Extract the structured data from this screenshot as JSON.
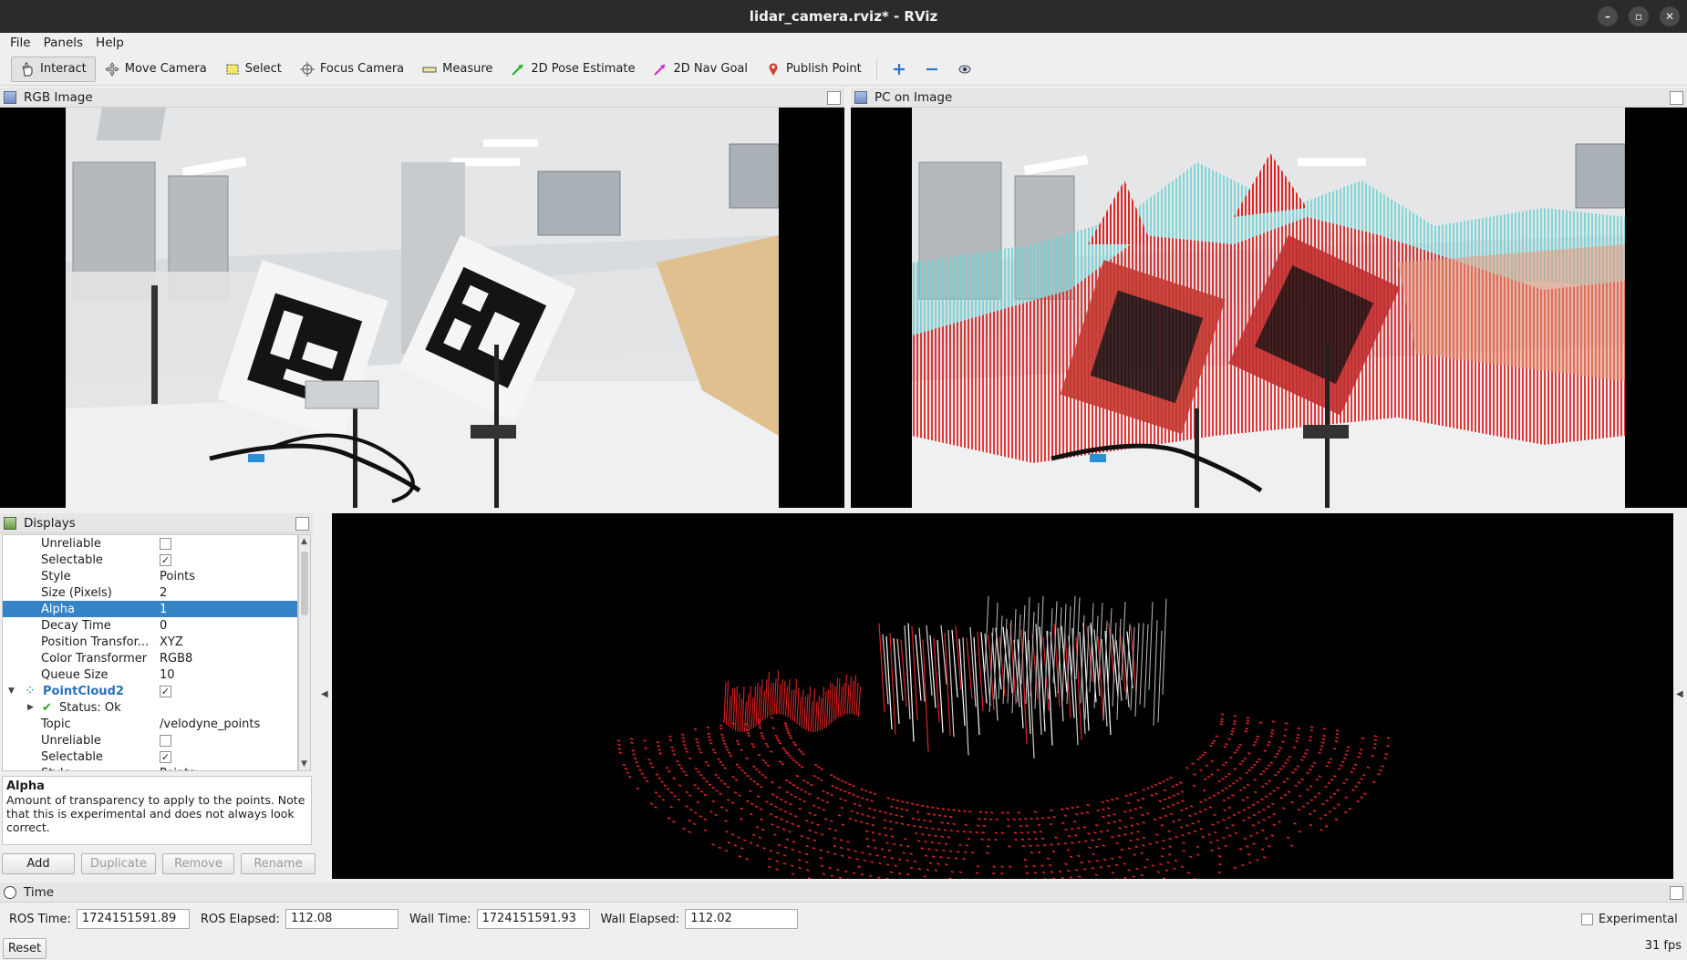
{
  "window": {
    "title": "lidar_camera.rviz* - RViz"
  },
  "menu": [
    "File",
    "Panels",
    "Help"
  ],
  "toolbar": {
    "interact": "Interact",
    "move_camera": "Move Camera",
    "select": "Select",
    "focus_camera": "Focus Camera",
    "measure": "Measure",
    "pose_estimate": "2D Pose Estimate",
    "nav_goal": "2D Nav Goal",
    "publish_point": "Publish Point"
  },
  "panels": {
    "rgb_image": "RGB Image",
    "pc_on_image": "PC on Image",
    "displays": "Displays",
    "time": "Time"
  },
  "displays": {
    "rows": [
      {
        "key": "Unreliable",
        "check": false
      },
      {
        "key": "Selectable",
        "check": true
      },
      {
        "key": "Style",
        "value": "Points"
      },
      {
        "key": "Size (Pixels)",
        "value": "2"
      },
      {
        "key": "Alpha",
        "value": "1",
        "selected": true
      },
      {
        "key": "Decay Time",
        "value": "0"
      },
      {
        "key": "Position Transfor...",
        "value": "XYZ"
      },
      {
        "key": "Color Transformer",
        "value": "RGB8"
      },
      {
        "key": "Queue Size",
        "value": "10"
      },
      {
        "key": "PointCloud2",
        "check": true,
        "top": true
      },
      {
        "key": "Status: Ok",
        "status": true
      },
      {
        "key": "Topic",
        "value": "/velodyne_points"
      },
      {
        "key": "Unreliable",
        "check": false
      },
      {
        "key": "Selectable",
        "check": true
      },
      {
        "key": "Style",
        "value": "Points"
      }
    ],
    "description_title": "Alpha",
    "description_text": "Amount of transparency to apply to the points. Note that this is experimental and does not always look correct.",
    "buttons": {
      "add": "Add",
      "duplicate": "Duplicate",
      "remove": "Remove",
      "rename": "Rename"
    }
  },
  "time": {
    "ros_time_label": "ROS Time:",
    "ros_time": "1724151591.89",
    "ros_elapsed_label": "ROS Elapsed:",
    "ros_elapsed": "112.08",
    "wall_time_label": "Wall Time:",
    "wall_time": "1724151591.93",
    "wall_elapsed_label": "Wall Elapsed:",
    "wall_elapsed": "112.02",
    "experimental": "Experimental",
    "reset": "Reset",
    "fps": "31 fps"
  },
  "colors": {
    "accent": "#3584c8",
    "cloud_red": "#e02424",
    "cloud_cyan": "#6fd3d3"
  }
}
